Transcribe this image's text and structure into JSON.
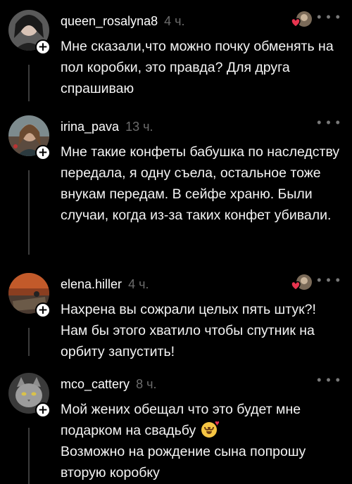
{
  "comments": [
    {
      "username": "queen_rosalyna8",
      "time": "4 ч.",
      "text": "Мне сказали,что можно почку обменять на пол коробки, это правда? Для друга спрашиваю",
      "liked_by_author": true
    },
    {
      "username": "irina_pava",
      "time": "13 ч.",
      "text": "Мне такие конфеты бабушка по наследству передала, я одну съела, остальное тоже внукам передам. В сейфе храню. Были случаи, когда из-за таких конфет убивали.",
      "liked_by_author": false
    },
    {
      "username": "elena.hiller",
      "time": "4 ч.",
      "text": "Нахрена вы сожрали целых пять штук?! Нам бы этого хватило чтобы спутник на орбиту запустить!",
      "liked_by_author": true
    },
    {
      "username": "mco_cattery",
      "time": "8 ч.",
      "text_line1": "Мой жених обещал что это будет мне подарком на свадьбу",
      "text_line2": "Возможно на рождение сына попрошу вторую коробку",
      "liked_by_author": false
    }
  ],
  "more_label": "• • •",
  "plus_label": "+",
  "icons": {
    "more": "more-icon",
    "follow": "plus-icon",
    "creator_like": "creator-heart-icon",
    "emoji": "smiling-face-with-hearts-emoji"
  },
  "colors": {
    "background": "#000000",
    "time": "#6c6c6c",
    "heart": "#e8344f"
  }
}
